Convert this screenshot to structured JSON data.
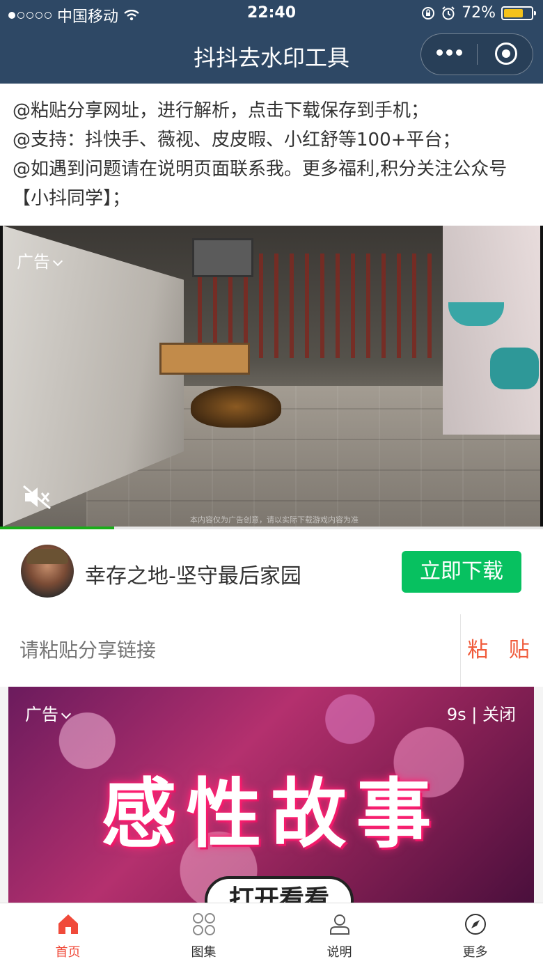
{
  "status_bar": {
    "carrier": "中国移动",
    "time": "22:40",
    "battery": "72%",
    "battery_level": 0.72
  },
  "navbar": {
    "title": "抖抖去水印工具"
  },
  "intro": {
    "lines": [
      "@粘贴分享网址，进行解析，点击下载保存到手机；",
      "@支持：抖快手、薇视、皮皮暇、小红舒等100+平台；",
      "@如遇到问题请在说明页面联系我。更多福利,积分关注公众号【小抖同学】；"
    ]
  },
  "ad1": {
    "label": "广告",
    "caption": "本内容仅为广告创意，请以实际下载游戏内容为准",
    "progress": 0.21,
    "app_name": "幸存之地-坚守最后家园",
    "download_label": "立即下载"
  },
  "paste": {
    "placeholder": "请粘贴分享链接",
    "button_label": "粘 贴"
  },
  "ad2": {
    "label": "广告",
    "countdown": "9s | 关闭",
    "title": "感性故事",
    "button_label": "打开看看"
  },
  "tabbar": {
    "items": [
      {
        "label": "首页",
        "icon": "home-icon",
        "active": true
      },
      {
        "label": "图集",
        "icon": "grid-icon",
        "active": false
      },
      {
        "label": "说明",
        "icon": "user-icon",
        "active": false
      },
      {
        "label": "更多",
        "icon": "compass-icon",
        "active": false
      }
    ]
  },
  "colors": {
    "header": "#2e4865",
    "accent_green": "#07c160",
    "accent_red": "#f04a3a"
  }
}
